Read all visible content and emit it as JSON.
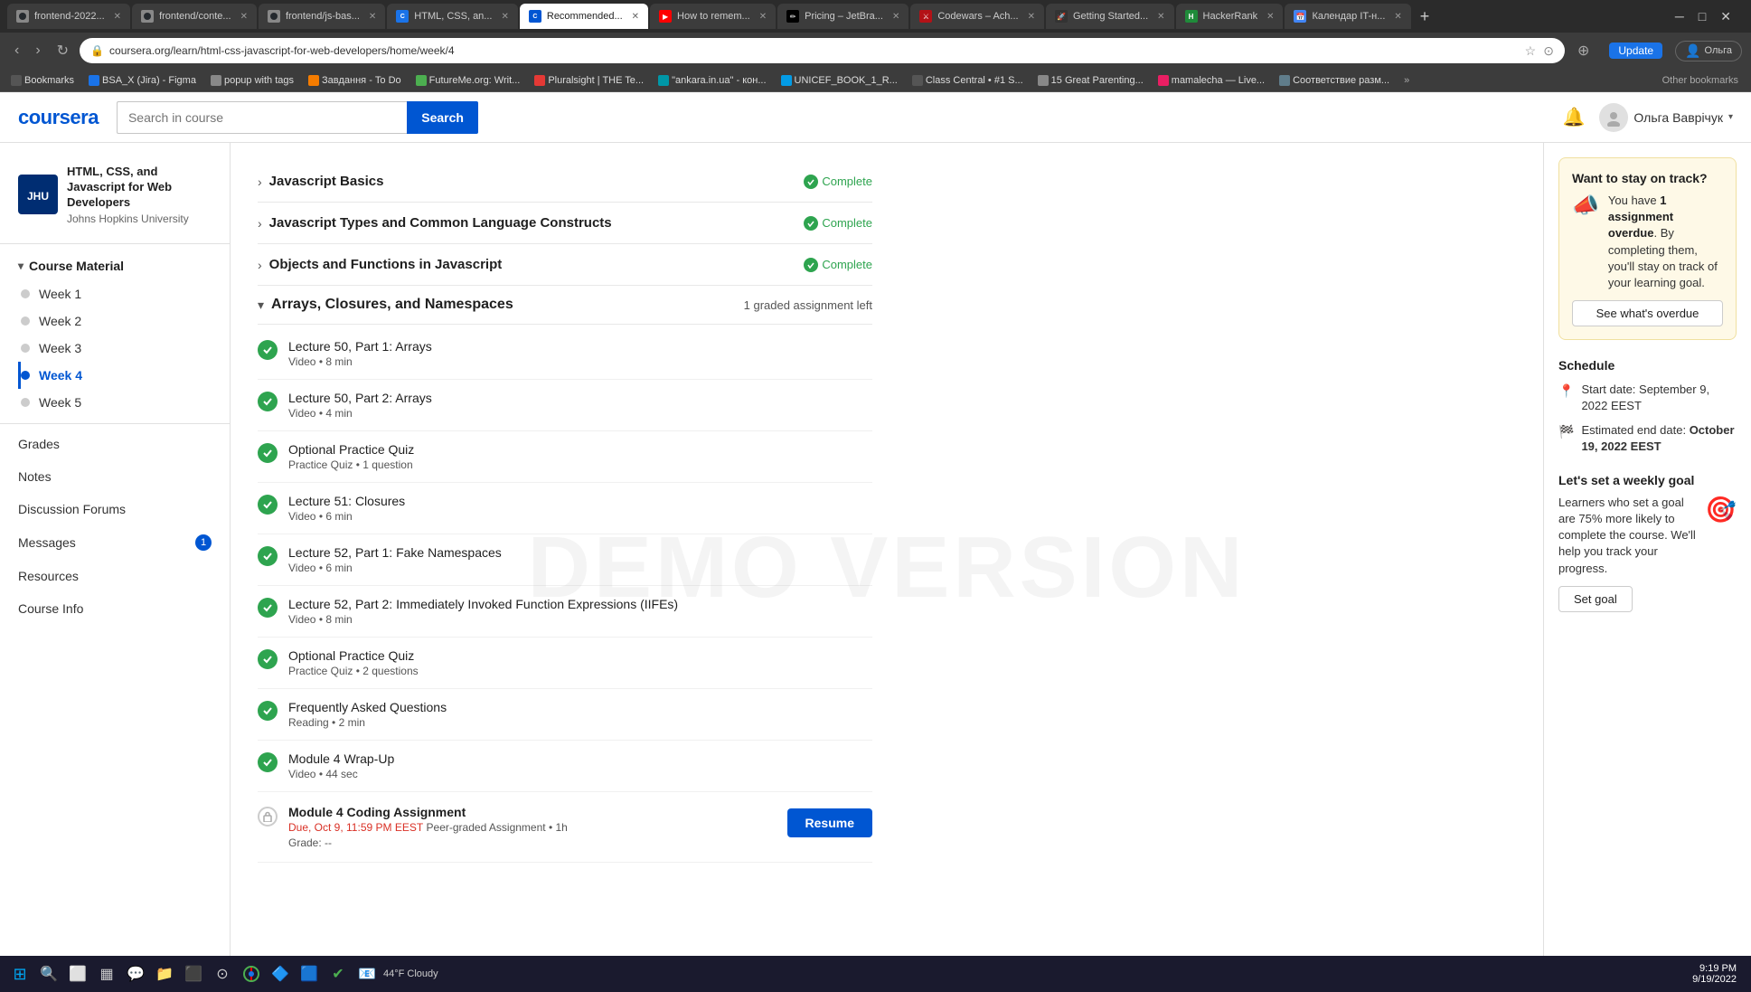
{
  "browser": {
    "tabs": [
      {
        "id": "tab1",
        "favicon": "gh",
        "title": "frontend-2022...",
        "active": false
      },
      {
        "id": "tab2",
        "favicon": "gh",
        "title": "frontend/conte...",
        "active": false
      },
      {
        "id": "tab3",
        "favicon": "gh",
        "title": "frontend/js-bas...",
        "active": false
      },
      {
        "id": "tab4",
        "favicon": "🌐",
        "title": "HTML, CSS, an...",
        "active": false
      },
      {
        "id": "tab5",
        "favicon": "🔖",
        "title": "Recommended...",
        "active": true
      },
      {
        "id": "tab6",
        "favicon": "▶",
        "title": "How to remem...",
        "active": false
      },
      {
        "id": "tab7",
        "favicon": "✏",
        "title": "Pricing – JetBra...",
        "active": false
      },
      {
        "id": "tab8",
        "favicon": "⚔",
        "title": "Codewars – Ach...",
        "active": false
      },
      {
        "id": "tab9",
        "favicon": "🚀",
        "title": "Getting Started...",
        "active": false
      },
      {
        "id": "tab10",
        "favicon": "H",
        "title": "HackerRank",
        "active": false
      },
      {
        "id": "tab11",
        "favicon": "📅",
        "title": "Календар IT-н...",
        "active": false
      }
    ],
    "address": "coursera.org/learn/html-css-javascript-for-web-developers/home/week/4",
    "update_label": "Update"
  },
  "bookmarks": [
    {
      "label": "Bookmarks"
    },
    {
      "label": "BSA_X (Jira) - Figma"
    },
    {
      "label": "popup with tags"
    },
    {
      "label": "Завдання - To Do"
    },
    {
      "label": "FutureMe.org: Writ..."
    },
    {
      "label": "Pluralsight | THE Te..."
    },
    {
      "label": "\"ankara.in.ua\" - кон..."
    },
    {
      "label": "UNICEF_BOOK_1_R..."
    },
    {
      "label": "Class Central • #1 S..."
    },
    {
      "label": "15 Great Parenting..."
    },
    {
      "label": "mamalecha — Live..."
    },
    {
      "label": "Соответствие разм..."
    }
  ],
  "header": {
    "logo": "coursera",
    "search_placeholder": "Search in course",
    "search_btn": "Search",
    "notification_icon": "🔔",
    "user_name": "Ольга Ваврічук"
  },
  "sidebar": {
    "course_title": "HTML, CSS, and Javascript for Web Developers",
    "university": "Johns Hopkins University",
    "course_material_label": "Course Material",
    "weeks": [
      {
        "label": "Week 1",
        "active": false
      },
      {
        "label": "Week 2",
        "active": false
      },
      {
        "label": "Week 3",
        "active": false
      },
      {
        "label": "Week 4",
        "active": true
      },
      {
        "label": "Week 5",
        "active": false
      }
    ],
    "links": [
      {
        "label": "Grades",
        "badge": null
      },
      {
        "label": "Notes",
        "badge": null
      },
      {
        "label": "Discussion Forums",
        "badge": null
      },
      {
        "label": "Messages",
        "badge": "1"
      },
      {
        "label": "Resources",
        "badge": null
      },
      {
        "label": "Course Info",
        "badge": null
      }
    ]
  },
  "content": {
    "collapsed_rows": [
      {
        "title": "Javascript Basics",
        "complete": true,
        "complete_label": "Complete"
      },
      {
        "title": "Javascript Types and Common Language Constructs",
        "complete": true,
        "complete_label": "Complete"
      },
      {
        "title": "Objects and Functions in Javascript",
        "complete": true,
        "complete_label": "Complete"
      }
    ],
    "expanded_module": {
      "title": "Arrays, Closures, and Namespaces",
      "badge": "1 graded assignment left",
      "lessons": [
        {
          "name": "Lecture 50, Part 1: Arrays",
          "type": "Video",
          "duration": "8 min",
          "complete": true
        },
        {
          "name": "Lecture 50, Part 2: Arrays",
          "type": "Video",
          "duration": "4 min",
          "complete": true
        },
        {
          "name": "Optional Practice Quiz",
          "type": "Practice Quiz",
          "duration": "1 question",
          "complete": true
        },
        {
          "name": "Lecture 51: Closures",
          "type": "Video",
          "duration": "6 min",
          "complete": true
        },
        {
          "name": "Lecture 52, Part 1: Fake Namespaces",
          "type": "Video",
          "duration": "6 min",
          "complete": true
        },
        {
          "name": "Lecture 52, Part 2: Immediately Invoked Function Expressions (IIFEs)",
          "type": "Video",
          "duration": "8 min",
          "complete": true
        },
        {
          "name": "Optional Practice Quiz",
          "type": "Practice Quiz",
          "duration": "2 questions",
          "complete": true
        },
        {
          "name": "Frequently Asked Questions",
          "type": "Reading",
          "duration": "2 min",
          "complete": true
        },
        {
          "name": "Module 4 Wrap-Up",
          "type": "Video",
          "duration": "44 sec",
          "complete": true
        }
      ],
      "assignment": {
        "name": "Module 4 Coding Assignment",
        "due_label": "Due, Oct 9, 11:59 PM EEST",
        "type_label": "Peer-graded Assignment",
        "duration": "1h",
        "grade_label": "Grade: --",
        "resume_btn": "Resume"
      }
    }
  },
  "right_panel": {
    "stay_on_track": {
      "title": "Want to stay on track?",
      "body": "You have",
      "bold": "1 assignment overdue",
      "body2": ". By completing them, you'll stay on track of your learning goal.",
      "btn_label": "See what's overdue"
    },
    "schedule": {
      "title": "Schedule",
      "start_label": "Start date: September 9, 2022 EEST",
      "end_label": "Estimated end date: October 19, 2022 EEST",
      "end_bold": "October 19, 2022 EEST"
    },
    "weekly_goal": {
      "title": "Let's set a weekly goal",
      "body": "Learners who set a goal are 75% more likely to complete the course. We'll help you track your progress.",
      "btn_label": "Set goal"
    }
  },
  "taskbar": {
    "time": "9:19 PM",
    "date": "9/19/2022",
    "weather": "44°F\nCloudy"
  }
}
